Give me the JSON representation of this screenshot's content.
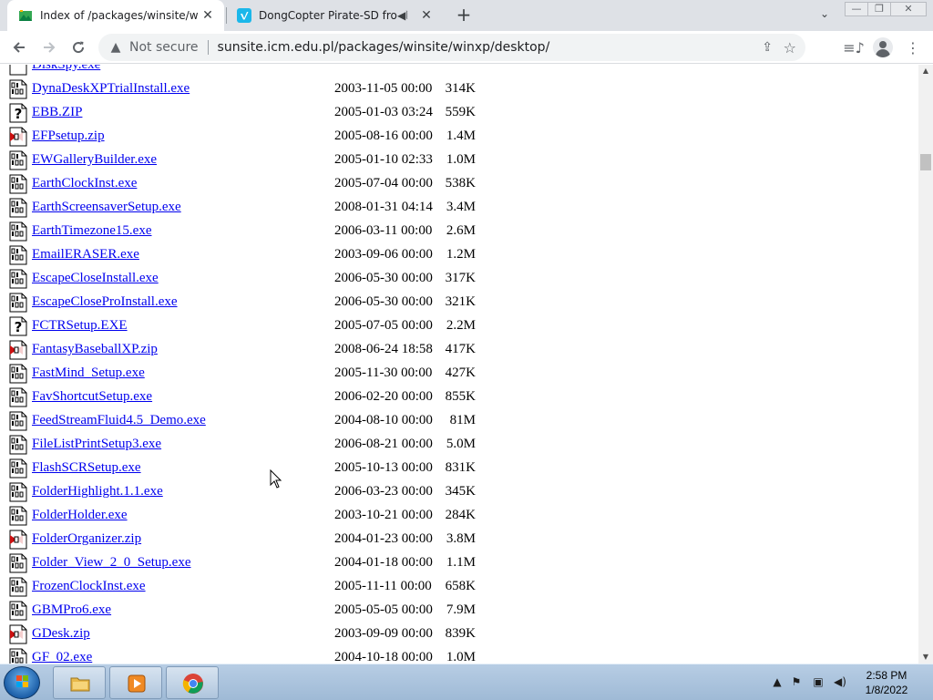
{
  "browser": {
    "tabs": [
      {
        "title": "Index of /packages/winsite/winxp",
        "active": true
      },
      {
        "title": "DongCopter Pirate-SD from",
        "active": false
      }
    ],
    "new_tab_label": "+",
    "omnibox": {
      "security_label": "Not secure",
      "url": "sunsite.icm.edu.pl/packages/winsite/winxp/desktop/"
    }
  },
  "listing": {
    "partial_top": "DiskSpy.exe",
    "rows": [
      {
        "name": "DynaDeskXPTrialInstall.exe",
        "date": "2003-11-05 00:00",
        "size": "314K",
        "icon": "binary-file-icon"
      },
      {
        "name": "EBB.ZIP",
        "date": "2005-01-03 03:24",
        "size": "559K",
        "icon": "unknown-file-icon"
      },
      {
        "name": "EFPsetup.zip",
        "date": "2005-08-16 00:00",
        "size": "1.4M",
        "icon": "compressed-file-icon"
      },
      {
        "name": "EWGalleryBuilder.exe",
        "date": "2005-01-10 02:33",
        "size": "1.0M",
        "icon": "binary-file-icon"
      },
      {
        "name": "EarthClockInst.exe",
        "date": "2005-07-04 00:00",
        "size": "538K",
        "icon": "binary-file-icon"
      },
      {
        "name": "EarthScreensaverSetup.exe",
        "date": "2008-01-31 04:14",
        "size": "3.4M",
        "icon": "binary-file-icon"
      },
      {
        "name": "EarthTimezone15.exe",
        "date": "2006-03-11 00:00",
        "size": "2.6M",
        "icon": "binary-file-icon"
      },
      {
        "name": "EmailERASER.exe",
        "date": "2003-09-06 00:00",
        "size": "1.2M",
        "icon": "binary-file-icon"
      },
      {
        "name": "EscapeCloseInstall.exe",
        "date": "2006-05-30 00:00",
        "size": "317K",
        "icon": "binary-file-icon"
      },
      {
        "name": "EscapeCloseProInstall.exe",
        "date": "2006-05-30 00:00",
        "size": "321K",
        "icon": "binary-file-icon"
      },
      {
        "name": "FCTRSetup.EXE",
        "date": "2005-07-05 00:00",
        "size": "2.2M",
        "icon": "unknown-file-icon"
      },
      {
        "name": "FantasyBaseballXP.zip",
        "date": "2008-06-24 18:58",
        "size": "417K",
        "icon": "compressed-file-icon"
      },
      {
        "name": "FastMind_Setup.exe",
        "date": "2005-11-30 00:00",
        "size": "427K",
        "icon": "binary-file-icon"
      },
      {
        "name": "FavShortcutSetup.exe",
        "date": "2006-02-20 00:00",
        "size": "855K",
        "icon": "binary-file-icon"
      },
      {
        "name": "FeedStreamFluid4.5_Demo.exe",
        "date": "2004-08-10 00:00",
        "size": "81M",
        "icon": "binary-file-icon"
      },
      {
        "name": "FileListPrintSetup3.exe",
        "date": "2006-08-21 00:00",
        "size": "5.0M",
        "icon": "binary-file-icon"
      },
      {
        "name": "FlashSCRSetup.exe",
        "date": "2005-10-13 00:00",
        "size": "831K",
        "icon": "binary-file-icon"
      },
      {
        "name": "FolderHighlight.1.1.exe",
        "date": "2006-03-23 00:00",
        "size": "345K",
        "icon": "binary-file-icon"
      },
      {
        "name": "FolderHolder.exe",
        "date": "2003-10-21 00:00",
        "size": "284K",
        "icon": "binary-file-icon"
      },
      {
        "name": "FolderOrganizer.zip",
        "date": "2004-01-23 00:00",
        "size": "3.8M",
        "icon": "compressed-file-icon"
      },
      {
        "name": "Folder_View_2_0_Setup.exe",
        "date": "2004-01-18 00:00",
        "size": "1.1M",
        "icon": "binary-file-icon"
      },
      {
        "name": "FrozenClockInst.exe",
        "date": "2005-11-11 00:00",
        "size": "658K",
        "icon": "binary-file-icon"
      },
      {
        "name": "GBMPro6.exe",
        "date": "2005-05-05 00:00",
        "size": "7.9M",
        "icon": "binary-file-icon"
      },
      {
        "name": "GDesk.zip",
        "date": "2003-09-09 00:00",
        "size": "839K",
        "icon": "compressed-file-icon"
      },
      {
        "name": "GF_02.exe",
        "date": "2004-10-18 00:00",
        "size": "1.0M",
        "icon": "binary-file-icon"
      }
    ]
  },
  "taskbar": {
    "clock_time": "2:58 PM",
    "clock_date": "1/8/2022",
    "items": [
      "file-explorer-icon",
      "media-player-icon",
      "chrome-icon"
    ]
  }
}
